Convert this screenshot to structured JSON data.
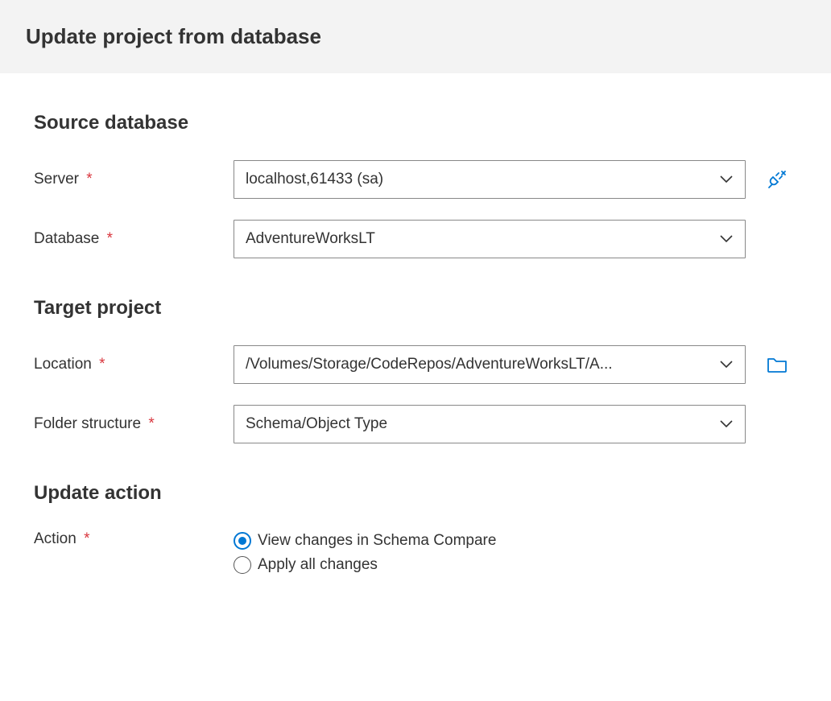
{
  "header": {
    "title": "Update project from database"
  },
  "sections": {
    "source": {
      "heading": "Source database",
      "serverLabel": "Server",
      "serverValue": "localhost,61433 (sa)",
      "databaseLabel": "Database",
      "databaseValue": "AdventureWorksLT"
    },
    "target": {
      "heading": "Target project",
      "locationLabel": "Location",
      "locationValue": "/Volumes/Storage/CodeRepos/AdventureWorksLT/A...",
      "folderLabel": "Folder structure",
      "folderValue": "Schema/Object Type"
    },
    "action": {
      "heading": "Update action",
      "actionLabel": "Action",
      "options": {
        "viewChanges": "View changes in Schema Compare",
        "applyAll": "Apply all changes"
      },
      "selected": "viewChanges"
    }
  },
  "icons": {
    "connect": "connect-icon",
    "folder": "folder-icon",
    "chevronDown": "chevron-down-icon"
  },
  "colors": {
    "accent": "#0078d4",
    "required": "#d9363e"
  }
}
